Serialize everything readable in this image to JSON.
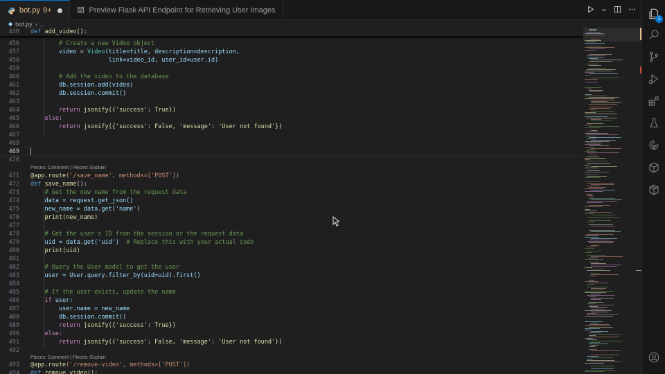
{
  "tabs": [
    {
      "label": "bot.py",
      "badge": "9+",
      "active": true
    },
    {
      "label": "Preview Flask API Endpoint for Retrieving User Images",
      "active": false
    }
  ],
  "breadcrumb": {
    "file": "bot.py",
    "more": "..."
  },
  "editor": {
    "sticky": {
      "num": "440",
      "code": "def add_video():"
    },
    "lens_1": "Pieces: Comment | Pieces: Explain",
    "lens_2": "Pieces: Comment | Pieces: Explain",
    "line_numbers": [
      "456",
      "457",
      "458",
      "459",
      "460",
      "461",
      "462",
      "463",
      "464",
      "465",
      "466",
      "467",
      "468",
      "469",
      "470",
      "471",
      "472",
      "473",
      "474",
      "475",
      "476",
      "477",
      "478",
      "479",
      "480",
      "481",
      "482",
      "483",
      "484",
      "485",
      "486",
      "487",
      "488",
      "489",
      "490",
      "491",
      "492",
      "493",
      "494"
    ],
    "current_line": "469",
    "code": {
      "l456": "# Create a new Video object",
      "l457a": "video",
      "l457b": " = ",
      "l457c": "Video",
      "l457d": "(title=title, description=description,",
      "l458": "link=video_id, user_id=user.id)",
      "l460": "# Add the video to the database",
      "l461": "db.session.add(video)",
      "l462": "db.session.commit()",
      "l464a": "return",
      "l464b": " jsonify({'success': True})",
      "l465": "else:",
      "l466a": "return",
      "l466b": " jsonify({'success': False, 'message': 'User not found'})",
      "l471a": "@app.route",
      "l471b": "('/save_name', methods=['POST'])",
      "l472a": "def",
      "l472b": " save_name",
      "l472c": "():",
      "l473": "# Get the new name from the request data",
      "l474": "data = request.get_json()",
      "l475": "new_name = data.get('name')",
      "l476": "print(new_name)",
      "l478": "# Get the user's ID from the session or the request data",
      "l479a": "uid = data.get('uid')",
      "l479b": "  # Replace this with your actual code",
      "l480": "print(uid)",
      "l482": "# Query the User model to get the user",
      "l483": "user = User.query.filter_by(uid=uid).first()",
      "l485": "# If the user exists, update the name",
      "l486a": "if",
      "l486b": " user:",
      "l487": "user.name = new_name",
      "l488": "db.session.commit()",
      "l489a": "return",
      "l489b": " jsonify({'success': True})",
      "l490": "else:",
      "l491a": "return",
      "l491b": " jsonify({'success': False, 'message': 'User not found'})",
      "l493a": "@app.route",
      "l493b": "('/remove-video', methods=['POST'])",
      "l494a": "def",
      "l494b": " remove_video",
      "l494c": "():"
    }
  },
  "colors": {
    "accent": "#0078d4",
    "modified": "#e2c08d"
  },
  "activity_bar": {
    "icons": [
      "explorer-icon",
      "search-icon",
      "source-control-icon",
      "run-debug-icon",
      "extensions-icon",
      "testing-icon",
      "pieces-icon",
      "remote-explorer-icon",
      "containers-icon",
      "account-icon"
    ],
    "explorer_badge": "1"
  }
}
